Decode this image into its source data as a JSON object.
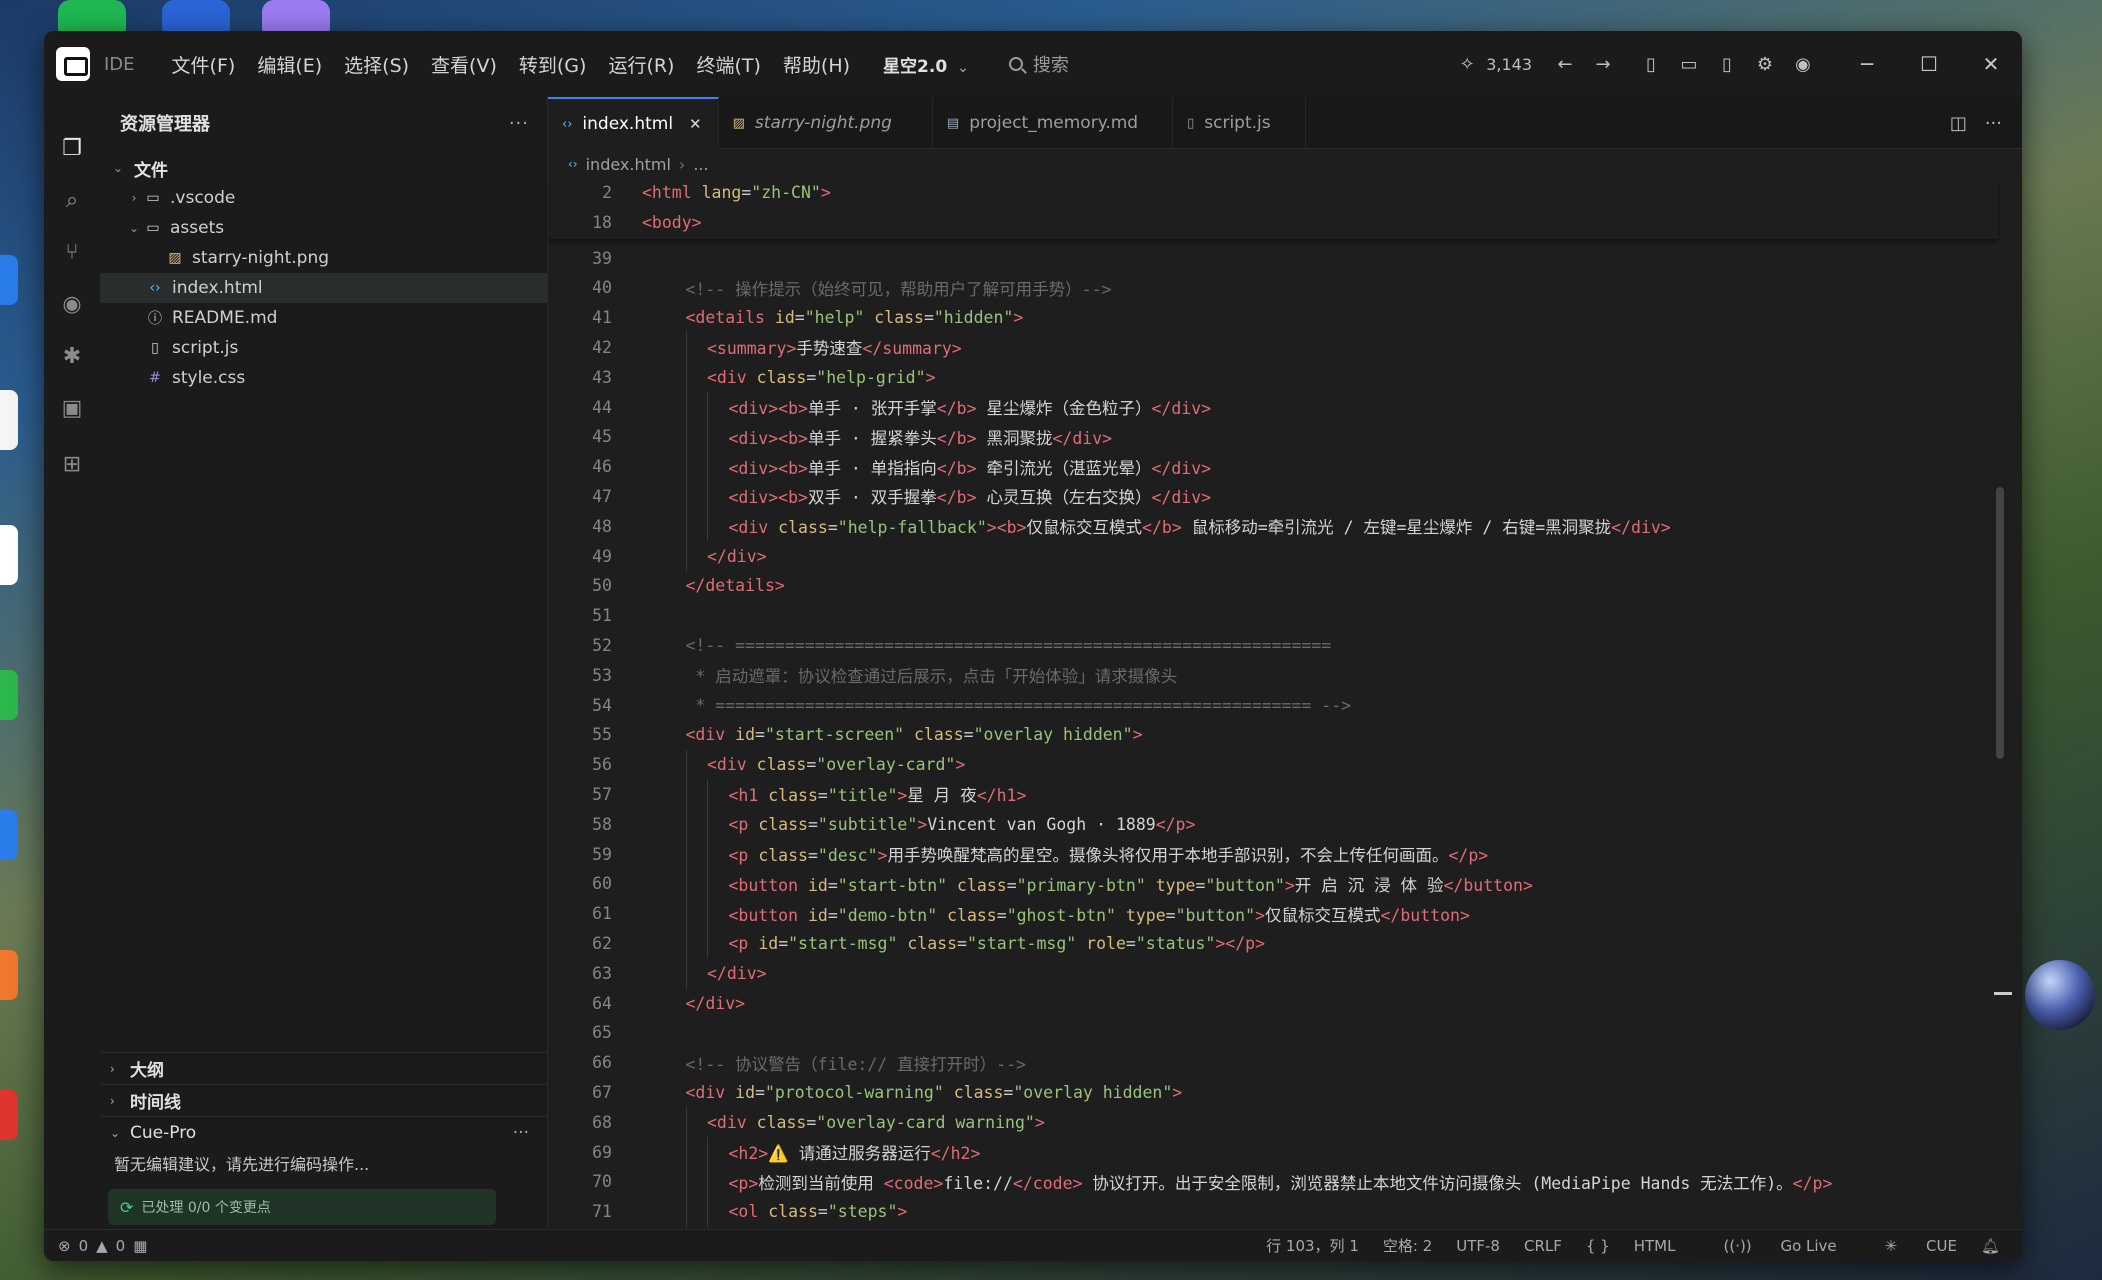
{
  "titlebar": {
    "app_name": "IDE",
    "menu": [
      "文件(F)",
      "编辑(E)",
      "选择(S)",
      "查看(V)",
      "转到(G)",
      "运行(R)",
      "终端(T)",
      "帮助(H)"
    ],
    "workspace": "星空2.0",
    "search_placeholder": "搜索",
    "credit_count": "3,143"
  },
  "sidebar": {
    "title": "资源管理器",
    "root": "文件",
    "items": [
      {
        "label": ".vscode",
        "kind": "folder",
        "icon": "folder-icon"
      },
      {
        "label": "assets",
        "kind": "folder-open",
        "icon": "folder-open-icon"
      },
      {
        "label": "starry-night.png",
        "kind": "image",
        "icon": "image-file-icon"
      },
      {
        "label": "index.html",
        "kind": "html",
        "icon": "html-file-icon",
        "selected": true
      },
      {
        "label": "README.md",
        "kind": "info",
        "icon": "info-file-icon"
      },
      {
        "label": "script.js",
        "kind": "file",
        "icon": "file-icon"
      },
      {
        "label": "style.css",
        "kind": "css",
        "icon": "css-file-icon"
      }
    ],
    "sections": {
      "outline": "大纲",
      "timeline": "时间线",
      "cue": "Cue-Pro"
    },
    "cue_message": "暂无编辑建议，请先进行编码操作...",
    "cue_status": "已处理 0/0 个变更点"
  },
  "tabs": [
    {
      "label": "index.html",
      "active": true
    },
    {
      "label": "starry-night.png",
      "active": false
    },
    {
      "label": "project_memory.md",
      "active": false
    },
    {
      "label": "script.js",
      "active": false
    }
  ],
  "breadcrumb": {
    "file": "index.html",
    "more": "..."
  },
  "sticky_lines": [
    {
      "n": "2",
      "tokens": [
        [
          "tag",
          "<html "
        ],
        [
          "att",
          "lang"
        ],
        [
          "pun",
          "="
        ],
        [
          "str",
          "\"zh-CN\""
        ],
        [
          "tag",
          ">"
        ]
      ]
    },
    {
      "n": "18",
      "tokens": [
        [
          "tag",
          "<body>"
        ]
      ]
    }
  ],
  "code_lines": [
    {
      "n": "39",
      "indent": 0,
      "tokens": []
    },
    {
      "n": "40",
      "indent": 1,
      "tokens": [
        [
          "cmt",
          "<!-- 操作提示（始终可见，帮助用户了解可用手势）-->"
        ]
      ]
    },
    {
      "n": "41",
      "indent": 1,
      "tokens": [
        [
          "tag",
          "<details "
        ],
        [
          "att",
          "id"
        ],
        [
          "pun",
          "="
        ],
        [
          "str",
          "\"help\""
        ],
        [
          "att",
          " class"
        ],
        [
          "pun",
          "="
        ],
        [
          "str",
          "\"hidden\""
        ],
        [
          "tag",
          ">"
        ]
      ]
    },
    {
      "n": "42",
      "indent": 2,
      "tokens": [
        [
          "tag",
          "<summary>"
        ],
        [
          "txt",
          "手势速查"
        ],
        [
          "tag",
          "</summary>"
        ]
      ]
    },
    {
      "n": "43",
      "indent": 2,
      "tokens": [
        [
          "tag",
          "<div "
        ],
        [
          "att",
          "class"
        ],
        [
          "pun",
          "="
        ],
        [
          "str",
          "\"help-grid\""
        ],
        [
          "tag",
          ">"
        ]
      ]
    },
    {
      "n": "44",
      "indent": 3,
      "tokens": [
        [
          "tag",
          "<div><b>"
        ],
        [
          "txt",
          "单手 · 张开手掌"
        ],
        [
          "tag",
          "</b>"
        ],
        [
          "txt",
          " 星尘爆炸（金色粒子）"
        ],
        [
          "tag",
          "</div>"
        ]
      ]
    },
    {
      "n": "45",
      "indent": 3,
      "tokens": [
        [
          "tag",
          "<div><b>"
        ],
        [
          "txt",
          "单手 · 握紧拳头"
        ],
        [
          "tag",
          "</b>"
        ],
        [
          "txt",
          " 黑洞聚拢"
        ],
        [
          "tag",
          "</div>"
        ]
      ]
    },
    {
      "n": "46",
      "indent": 3,
      "tokens": [
        [
          "tag",
          "<div><b>"
        ],
        [
          "txt",
          "单手 · 单指指向"
        ],
        [
          "tag",
          "</b>"
        ],
        [
          "txt",
          " 牵引流光（湛蓝光晕）"
        ],
        [
          "tag",
          "</div>"
        ]
      ]
    },
    {
      "n": "47",
      "indent": 3,
      "tokens": [
        [
          "tag",
          "<div><b>"
        ],
        [
          "txt",
          "双手 · 双手握拳"
        ],
        [
          "tag",
          "</b>"
        ],
        [
          "txt",
          " 心灵互换（左右交换）"
        ],
        [
          "tag",
          "</div>"
        ]
      ]
    },
    {
      "n": "48",
      "indent": 3,
      "tokens": [
        [
          "tag",
          "<div "
        ],
        [
          "att",
          "class"
        ],
        [
          "pun",
          "="
        ],
        [
          "str",
          "\"help-fallback\""
        ],
        [
          "tag",
          "><b>"
        ],
        [
          "txt",
          "仅鼠标交互模式"
        ],
        [
          "tag",
          "</b>"
        ],
        [
          "txt",
          " 鼠标移动=牵引流光 / 左键=星尘爆炸 / 右键=黑洞聚拢"
        ],
        [
          "tag",
          "</div>"
        ]
      ]
    },
    {
      "n": "49",
      "indent": 2,
      "tokens": [
        [
          "tag",
          "</div>"
        ]
      ]
    },
    {
      "n": "50",
      "indent": 1,
      "tokens": [
        [
          "tag",
          "</details>"
        ]
      ]
    },
    {
      "n": "51",
      "indent": 0,
      "tokens": []
    },
    {
      "n": "52",
      "indent": 1,
      "tokens": [
        [
          "cmt",
          "<!-- ============================================================"
        ]
      ]
    },
    {
      "n": "53",
      "indent": 1,
      "tokens": [
        [
          "cmt",
          " * 启动遮罩：协议检查通过后展示，点击「开始体验」请求摄像头"
        ]
      ]
    },
    {
      "n": "54",
      "indent": 1,
      "tokens": [
        [
          "cmt",
          " * ============================================================ -->"
        ]
      ]
    },
    {
      "n": "55",
      "indent": 1,
      "tokens": [
        [
          "tag",
          "<div "
        ],
        [
          "att",
          "id"
        ],
        [
          "pun",
          "="
        ],
        [
          "str",
          "\"start-screen\""
        ],
        [
          "att",
          " class"
        ],
        [
          "pun",
          "="
        ],
        [
          "str",
          "\"overlay hidden\""
        ],
        [
          "tag",
          ">"
        ]
      ]
    },
    {
      "n": "56",
      "indent": 2,
      "tokens": [
        [
          "tag",
          "<div "
        ],
        [
          "att",
          "class"
        ],
        [
          "pun",
          "="
        ],
        [
          "str",
          "\"overlay-card\""
        ],
        [
          "tag",
          ">"
        ]
      ]
    },
    {
      "n": "57",
      "indent": 3,
      "tokens": [
        [
          "tag",
          "<h1 "
        ],
        [
          "att",
          "class"
        ],
        [
          "pun",
          "="
        ],
        [
          "str",
          "\"title\""
        ],
        [
          "tag",
          ">"
        ],
        [
          "txt",
          "星 月 夜"
        ],
        [
          "tag",
          "</h1>"
        ]
      ]
    },
    {
      "n": "58",
      "indent": 3,
      "tokens": [
        [
          "tag",
          "<p "
        ],
        [
          "att",
          "class"
        ],
        [
          "pun",
          "="
        ],
        [
          "str",
          "\"subtitle\""
        ],
        [
          "tag",
          ">"
        ],
        [
          "txt",
          "Vincent van Gogh · 1889"
        ],
        [
          "tag",
          "</p>"
        ]
      ]
    },
    {
      "n": "59",
      "indent": 3,
      "tokens": [
        [
          "tag",
          "<p "
        ],
        [
          "att",
          "class"
        ],
        [
          "pun",
          "="
        ],
        [
          "str",
          "\"desc\""
        ],
        [
          "tag",
          ">"
        ],
        [
          "txt",
          "用手势唤醒梵高的星空。摄像头将仅用于本地手部识别，不会上传任何画面。"
        ],
        [
          "tag",
          "</p>"
        ]
      ]
    },
    {
      "n": "60",
      "indent": 3,
      "tokens": [
        [
          "tag",
          "<button "
        ],
        [
          "att",
          "id"
        ],
        [
          "pun",
          "="
        ],
        [
          "str",
          "\"start-btn\""
        ],
        [
          "att",
          " class"
        ],
        [
          "pun",
          "="
        ],
        [
          "str",
          "\"primary-btn\""
        ],
        [
          "att",
          " type"
        ],
        [
          "pun",
          "="
        ],
        [
          "str",
          "\"button\""
        ],
        [
          "tag",
          ">"
        ],
        [
          "txt",
          "开 启 沉 浸 体 验"
        ],
        [
          "tag",
          "</button>"
        ]
      ]
    },
    {
      "n": "61",
      "indent": 3,
      "tokens": [
        [
          "tag",
          "<button "
        ],
        [
          "att",
          "id"
        ],
        [
          "pun",
          "="
        ],
        [
          "str",
          "\"demo-btn\""
        ],
        [
          "att",
          " class"
        ],
        [
          "pun",
          "="
        ],
        [
          "str",
          "\"ghost-btn\""
        ],
        [
          "att",
          " type"
        ],
        [
          "pun",
          "="
        ],
        [
          "str",
          "\"button\""
        ],
        [
          "tag",
          ">"
        ],
        [
          "txt",
          "仅鼠标交互模式"
        ],
        [
          "tag",
          "</button>"
        ]
      ]
    },
    {
      "n": "62",
      "indent": 3,
      "tokens": [
        [
          "tag",
          "<p "
        ],
        [
          "att",
          "id"
        ],
        [
          "pun",
          "="
        ],
        [
          "str",
          "\"start-msg\""
        ],
        [
          "att",
          " class"
        ],
        [
          "pun",
          "="
        ],
        [
          "str",
          "\"start-msg\""
        ],
        [
          "att",
          " role"
        ],
        [
          "pun",
          "="
        ],
        [
          "str",
          "\"status\""
        ],
        [
          "tag",
          "></p>"
        ]
      ]
    },
    {
      "n": "63",
      "indent": 2,
      "tokens": [
        [
          "tag",
          "</div>"
        ]
      ]
    },
    {
      "n": "64",
      "indent": 1,
      "tokens": [
        [
          "tag",
          "</div>"
        ]
      ]
    },
    {
      "n": "65",
      "indent": 0,
      "tokens": []
    },
    {
      "n": "66",
      "indent": 1,
      "tokens": [
        [
          "cmt",
          "<!-- 协议警告（file:// 直接打开时）-->"
        ]
      ]
    },
    {
      "n": "67",
      "indent": 1,
      "tokens": [
        [
          "tag",
          "<div "
        ],
        [
          "att",
          "id"
        ],
        [
          "pun",
          "="
        ],
        [
          "str",
          "\"protocol-warning\""
        ],
        [
          "att",
          " class"
        ],
        [
          "pun",
          "="
        ],
        [
          "str",
          "\"overlay hidden\""
        ],
        [
          "tag",
          ">"
        ]
      ]
    },
    {
      "n": "68",
      "indent": 2,
      "tokens": [
        [
          "tag",
          "<div "
        ],
        [
          "att",
          "class"
        ],
        [
          "pun",
          "="
        ],
        [
          "str",
          "\"overlay-card warning\""
        ],
        [
          "tag",
          ">"
        ]
      ]
    },
    {
      "n": "69",
      "indent": 3,
      "tokens": [
        [
          "tag",
          "<h2>"
        ],
        [
          "txt",
          "⚠️ 请通过服务器运行"
        ],
        [
          "tag",
          "</h2>"
        ]
      ]
    },
    {
      "n": "70",
      "indent": 3,
      "tokens": [
        [
          "tag",
          "<p>"
        ],
        [
          "txt",
          "检测到当前使用 "
        ],
        [
          "tag",
          "<code>"
        ],
        [
          "txt",
          "file://"
        ],
        [
          "tag",
          "</code>"
        ],
        [
          "txt",
          " 协议打开。出于安全限制，浏览器禁止本地文件访问摄像头 (MediaPipe Hands 无法工作)。"
        ],
        [
          "tag",
          "</p>"
        ]
      ]
    },
    {
      "n": "71",
      "indent": 3,
      "tokens": [
        [
          "tag",
          "<ol "
        ],
        [
          "att",
          "class"
        ],
        [
          "pun",
          "="
        ],
        [
          "str",
          "\"steps\""
        ],
        [
          "tag",
          ">"
        ]
      ]
    }
  ],
  "status": {
    "errors": "0",
    "warnings": "0",
    "position": "行 103，列 1",
    "spaces": "空格: 2",
    "encoding": "UTF-8",
    "eol": "CRLF",
    "braces": "{ }",
    "language": "HTML",
    "golive": "Go Live",
    "cue": "CUE"
  },
  "colors": {
    "accent": "#3b82f6",
    "tag": "#e06c75",
    "attr": "#d7ba7d",
    "string": "#98c379",
    "comment": "#6a6a6a"
  }
}
